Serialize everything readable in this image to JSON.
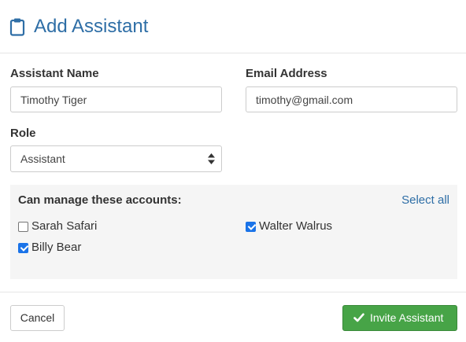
{
  "header": {
    "title": "Add Assistant",
    "icon": "clipboard-icon",
    "color": "#2e6ea6"
  },
  "form": {
    "name_label": "Assistant Name",
    "name_value": "Timothy Tiger",
    "email_label": "Email Address",
    "email_value": "timothy@gmail.com",
    "role_label": "Role",
    "role_value": "Assistant"
  },
  "accounts": {
    "title": "Can manage these accounts:",
    "select_all": "Select all",
    "items": [
      {
        "label": "Sarah Safari",
        "checked": false
      },
      {
        "label": "Walter Walrus",
        "checked": true
      },
      {
        "label": "Billy Bear",
        "checked": true
      }
    ]
  },
  "footer": {
    "cancel_label": "Cancel",
    "invite_label": "Invite Assistant",
    "invite_icon": "checkmark-icon",
    "invite_color": "#47a447"
  }
}
